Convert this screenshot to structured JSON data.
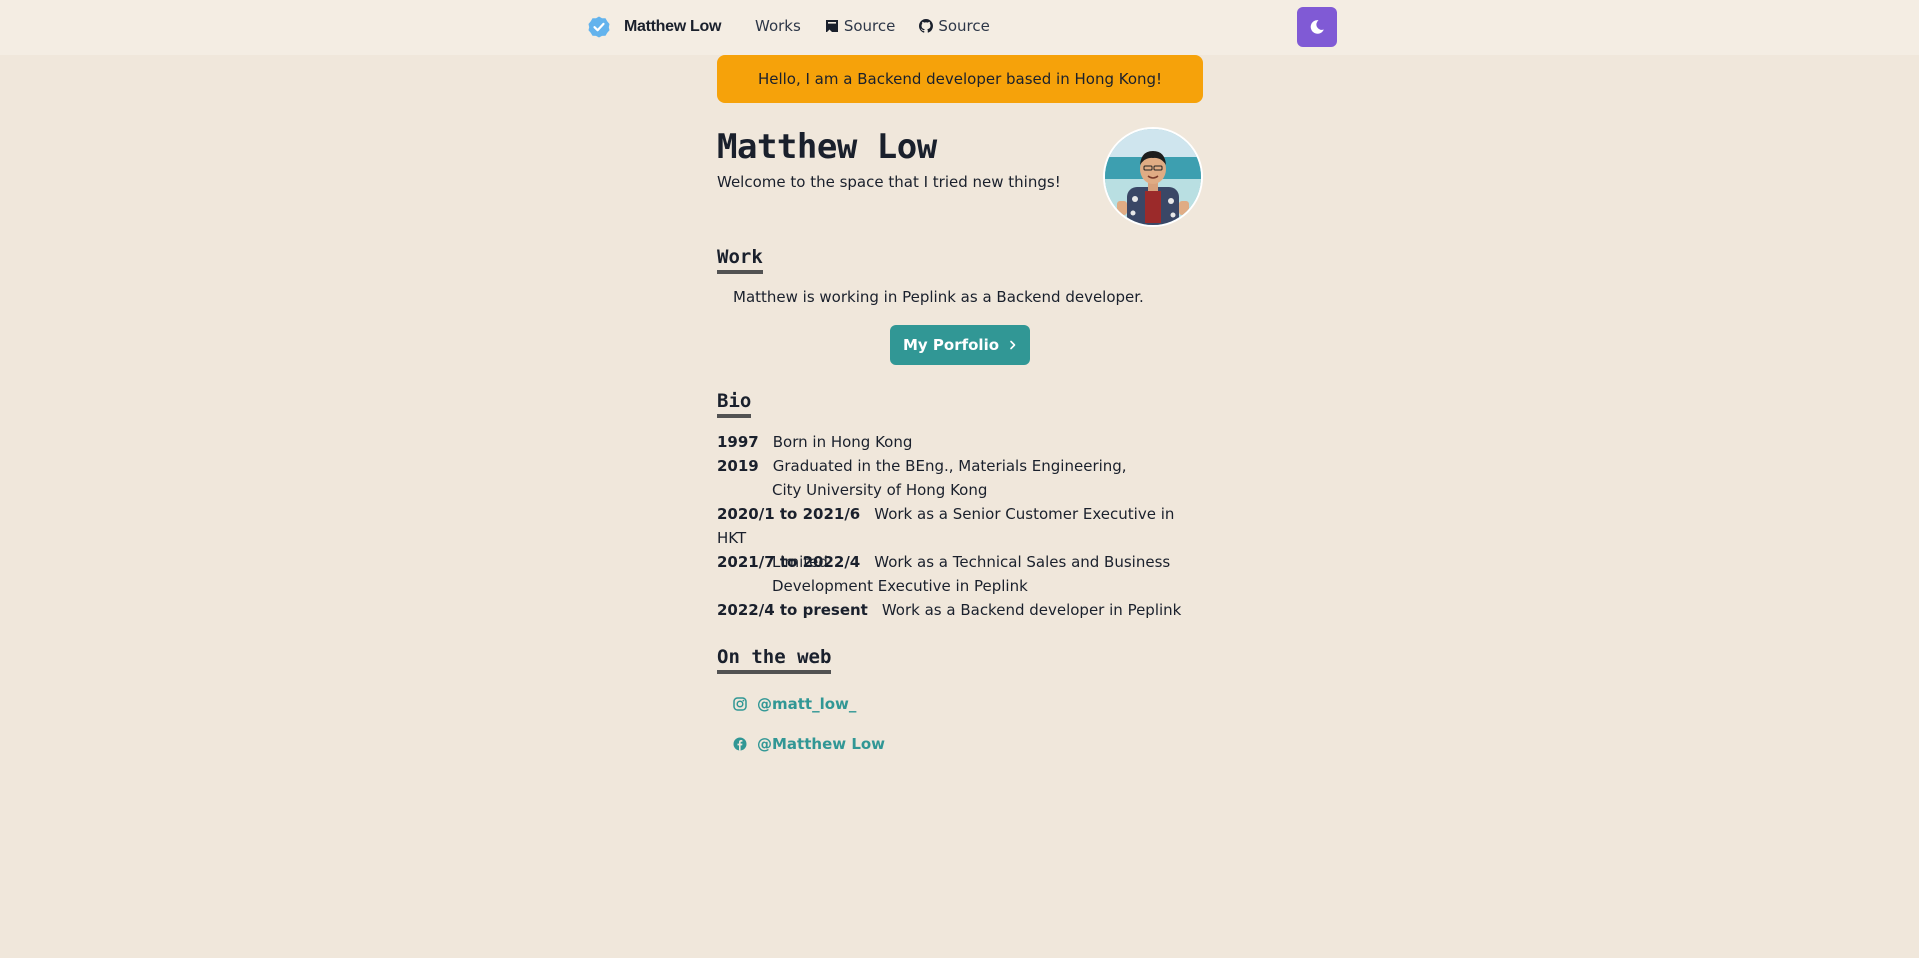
{
  "nav": {
    "brand": "Matthew Low",
    "links": [
      {
        "label": "Works",
        "icon": ""
      },
      {
        "label": "Source",
        "icon": "book-icon"
      },
      {
        "label": "Source",
        "icon": "github-icon"
      }
    ],
    "theme_toggle_icon": "moon-icon"
  },
  "hello_banner": "Hello, I am a Backend developer based in Hong Kong!",
  "profile": {
    "name": "Matthew Low",
    "tagline": "Welcome to the space that I tried new things!"
  },
  "work": {
    "title": "Work",
    "text": "Matthew is working in Peplink as a Backend developer.",
    "button_label": "My Porfolio"
  },
  "bio": {
    "title": "Bio",
    "entries": [
      {
        "year": "1997",
        "line1": "Born in Hong Kong",
        "line2": ""
      },
      {
        "year": "2019",
        "line1": "Graduated in the BEng., Materials Engineering,",
        "line2": "City University of Hong Kong"
      },
      {
        "year": "2020/1 to 2021/6",
        "line1": "Work as a Senior Customer Executive in HKT",
        "line2": "Limited"
      },
      {
        "year": "2021/7 to 2022/4",
        "line1": "Work as a Technical Sales and Business",
        "line2": "Development Executive in Peplink"
      },
      {
        "year": "2022/4 to present",
        "line1": "Work as a Backend developer in Peplink",
        "line2": ""
      }
    ]
  },
  "web": {
    "title": "On the web",
    "links": [
      {
        "label": "@matt_low_",
        "icon": "instagram-icon"
      },
      {
        "label": "@Matthew Low",
        "icon": "facebook-icon"
      }
    ]
  },
  "colors": {
    "background": "#f0e7db",
    "navbar": "#f4ede3",
    "banner": "#f6a20a",
    "accent": "#319795",
    "theme_button": "#805ad5"
  }
}
